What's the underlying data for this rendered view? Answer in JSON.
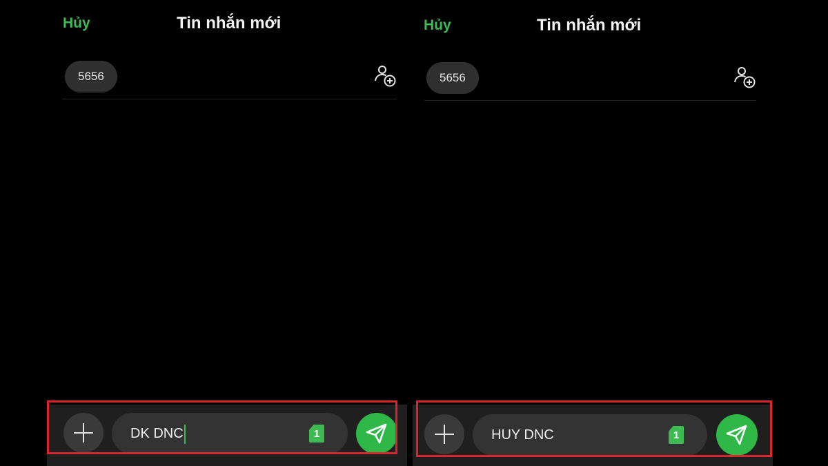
{
  "accent_color": "#3dbb52",
  "highlight_color": "#d7262e",
  "panels": [
    {
      "cancel_label": "Hủy",
      "title": "Tin nhắn mới",
      "recipient": "5656",
      "message_text": "DK DNC",
      "sim_label": "1",
      "icons": [
        "add-contact-icon",
        "plus-icon",
        "sim-icon",
        "send-icon"
      ]
    },
    {
      "cancel_label": "Hủy",
      "title": "Tin nhắn mới",
      "recipient": "5656",
      "message_text": "HUY DNC",
      "sim_label": "1",
      "icons": [
        "add-contact-icon",
        "plus-icon",
        "sim-icon",
        "send-icon"
      ]
    }
  ]
}
